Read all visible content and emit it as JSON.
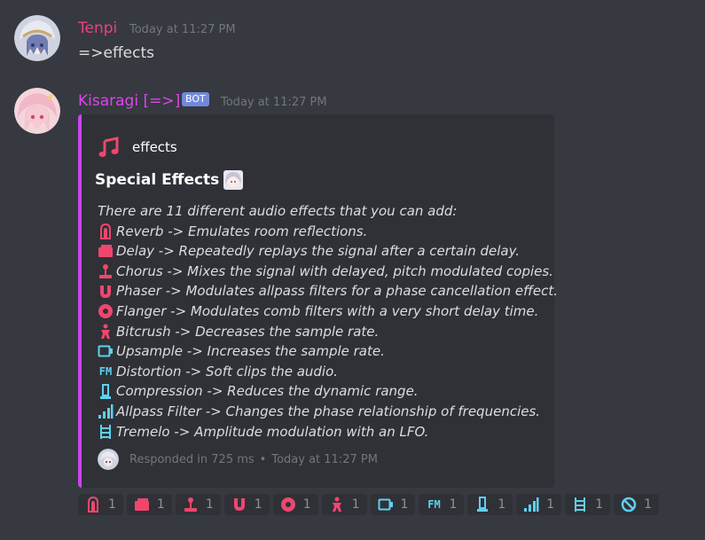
{
  "messages": [
    {
      "author": "Tenpi",
      "author_color": "#ec3f8a",
      "timestamp": "Today at 11:27 PM",
      "content": "=>effects"
    },
    {
      "author": "Kisaragi [=>]",
      "author_color": "#dd44ee",
      "bot_tag": "BOT",
      "timestamp": "Today at 11:27 PM",
      "embed": {
        "border_color": "#cc44ee",
        "author_name": "effects",
        "author_icon": "music-note-icon",
        "title": "Special Effects",
        "title_emote": "anime-girl-emote",
        "intro": "There are 11 different audio effects that you can add:",
        "effects": [
          {
            "icon": "reverb-icon",
            "text": "Reverb -> Emulates room reflections."
          },
          {
            "icon": "delay-icon",
            "text": "Delay -> Repeatedly replays the signal after a certain delay."
          },
          {
            "icon": "chorus-icon",
            "text": "Chorus -> Mixes the signal with delayed, pitch modulated copies."
          },
          {
            "icon": "phaser-icon",
            "text": "Phaser -> Modulates allpass filters for a phase cancellation effect."
          },
          {
            "icon": "flanger-icon",
            "text": "Flanger -> Modulates comb filters with a very short delay time."
          },
          {
            "icon": "bitcrush-icon",
            "text": "Bitcrush -> Decreases the sample rate."
          },
          {
            "icon": "upsample-icon",
            "text": "Upsample -> Increases the sample rate."
          },
          {
            "icon": "distortion-icon",
            "text": "Distortion -> Soft clips the audio."
          },
          {
            "icon": "compression-icon",
            "text": "Compression -> Reduces the dynamic range."
          },
          {
            "icon": "allpass-icon",
            "text": "Allpass Filter -> Changes the phase relationship of frequencies."
          },
          {
            "icon": "tremelo-icon",
            "text": "Tremelo -> Amplitude modulation with an LFO."
          }
        ],
        "footer_text": "Responded in 725 ms",
        "footer_separator": "•",
        "footer_timestamp": "Today at 11:27 PM"
      }
    }
  ],
  "reactions": [
    {
      "icon": "reverb-icon",
      "count": "1"
    },
    {
      "icon": "delay-icon",
      "count": "1"
    },
    {
      "icon": "chorus-icon",
      "count": "1"
    },
    {
      "icon": "phaser-icon",
      "count": "1"
    },
    {
      "icon": "flanger-icon",
      "count": "1"
    },
    {
      "icon": "bitcrush-icon",
      "count": "1"
    },
    {
      "icon": "upsample-icon",
      "count": "1"
    },
    {
      "icon": "distortion-icon",
      "count": "1"
    },
    {
      "icon": "compression-icon",
      "count": "1"
    },
    {
      "icon": "allpass-icon",
      "count": "1"
    },
    {
      "icon": "tremelo-icon",
      "count": "1"
    },
    {
      "icon": "cancel-icon",
      "count": "1"
    }
  ],
  "colors": {
    "background": "#36393f",
    "embed_background": "#2f3136",
    "pink_icon": "#f0466e",
    "cyan_icon": "#5fd0f0",
    "timestamp": "#72767d",
    "bot_tag": "#7289da"
  }
}
